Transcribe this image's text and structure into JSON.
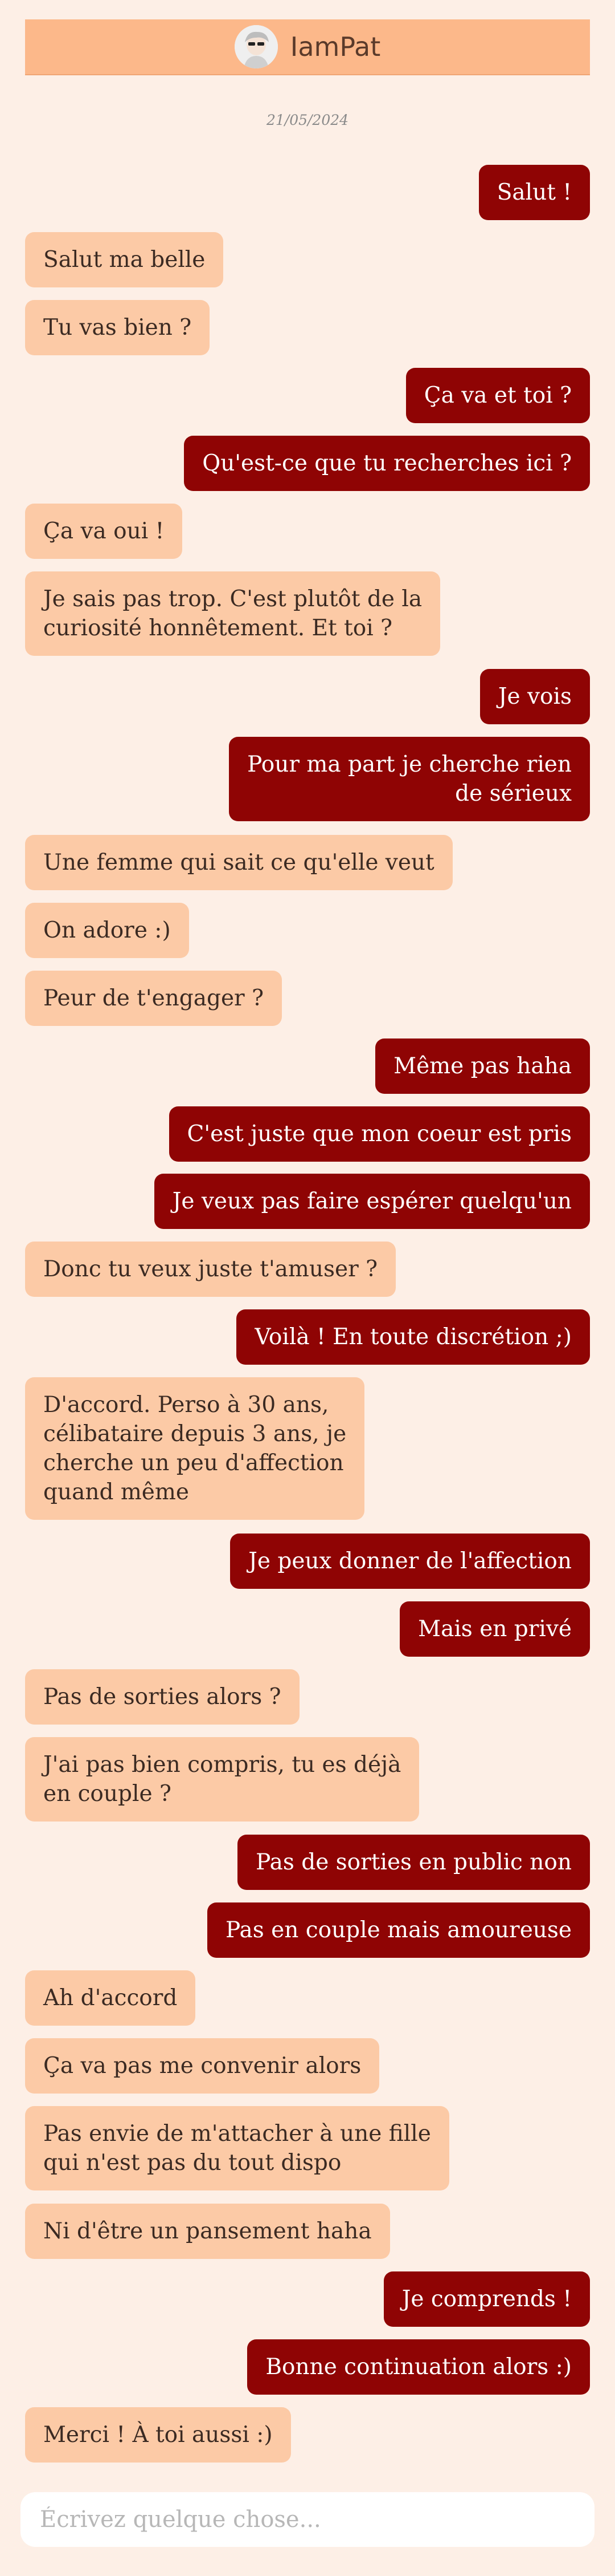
{
  "header": {
    "contact_name": "IamPat",
    "avatar_icon": "profile-avatar-icon"
  },
  "conversation": {
    "date": "21/05/2024",
    "messages": [
      {
        "dir": "out",
        "text": "Salut !"
      },
      {
        "dir": "in",
        "text": "Salut ma belle"
      },
      {
        "dir": "in",
        "text": "Tu vas bien ?"
      },
      {
        "dir": "out",
        "text": "Ça va et toi ?"
      },
      {
        "dir": "out",
        "text": "Qu'est-ce que tu recherches ici ?"
      },
      {
        "dir": "in",
        "text": "Ça va oui !"
      },
      {
        "dir": "in",
        "text": "Je sais pas trop. C'est plutôt de la\ncuriosité honnêtement. Et toi ?"
      },
      {
        "dir": "out",
        "text": "Je vois"
      },
      {
        "dir": "out",
        "text": "Pour ma part je cherche rien\nde sérieux"
      },
      {
        "dir": "in",
        "text": "Une femme qui sait ce qu'elle veut"
      },
      {
        "dir": "in",
        "text": "On adore :)"
      },
      {
        "dir": "in",
        "text": "Peur de t'engager ?"
      },
      {
        "dir": "out",
        "text": "Même pas haha"
      },
      {
        "dir": "out",
        "text": "C'est juste que mon coeur est pris"
      },
      {
        "dir": "out",
        "text": "Je veux pas faire espérer quelqu'un"
      },
      {
        "dir": "in",
        "text": "Donc tu veux juste t'amuser ?"
      },
      {
        "dir": "out",
        "text": "Voilà ! En toute discrétion ;)"
      },
      {
        "dir": "in",
        "text": "D'accord. Perso à 30 ans,\ncélibataire depuis 3 ans, je\ncherche un peu d'affection\nquand même"
      },
      {
        "dir": "out",
        "text": "Je peux donner de l'affection"
      },
      {
        "dir": "out",
        "text": "Mais en privé"
      },
      {
        "dir": "in",
        "text": "Pas de sorties alors ?"
      },
      {
        "dir": "in",
        "text": "J'ai pas bien compris, tu es déjà\nen couple ?"
      },
      {
        "dir": "out",
        "text": "Pas de sorties en public non"
      },
      {
        "dir": "out",
        "text": "Pas en couple mais amoureuse"
      },
      {
        "dir": "in",
        "text": "Ah d'accord"
      },
      {
        "dir": "in",
        "text": "Ça va pas me convenir alors"
      },
      {
        "dir": "in",
        "text": "Pas envie de m'attacher à une fille\nqui n'est pas du tout dispo"
      },
      {
        "dir": "in",
        "text": "Ni d'être un pansement haha"
      },
      {
        "dir": "out",
        "text": "Je comprends !"
      },
      {
        "dir": "out",
        "text": "Bonne continuation alors :)"
      },
      {
        "dir": "in",
        "text": "Merci ! À toi aussi :)"
      }
    ]
  },
  "composer": {
    "placeholder": "Écrivez quelque chose..."
  },
  "colors": {
    "background": "#fdefe6",
    "header": "#fcb88a",
    "incoming_bubble": "#fccaa6",
    "outgoing_bubble": "#8f0404"
  }
}
